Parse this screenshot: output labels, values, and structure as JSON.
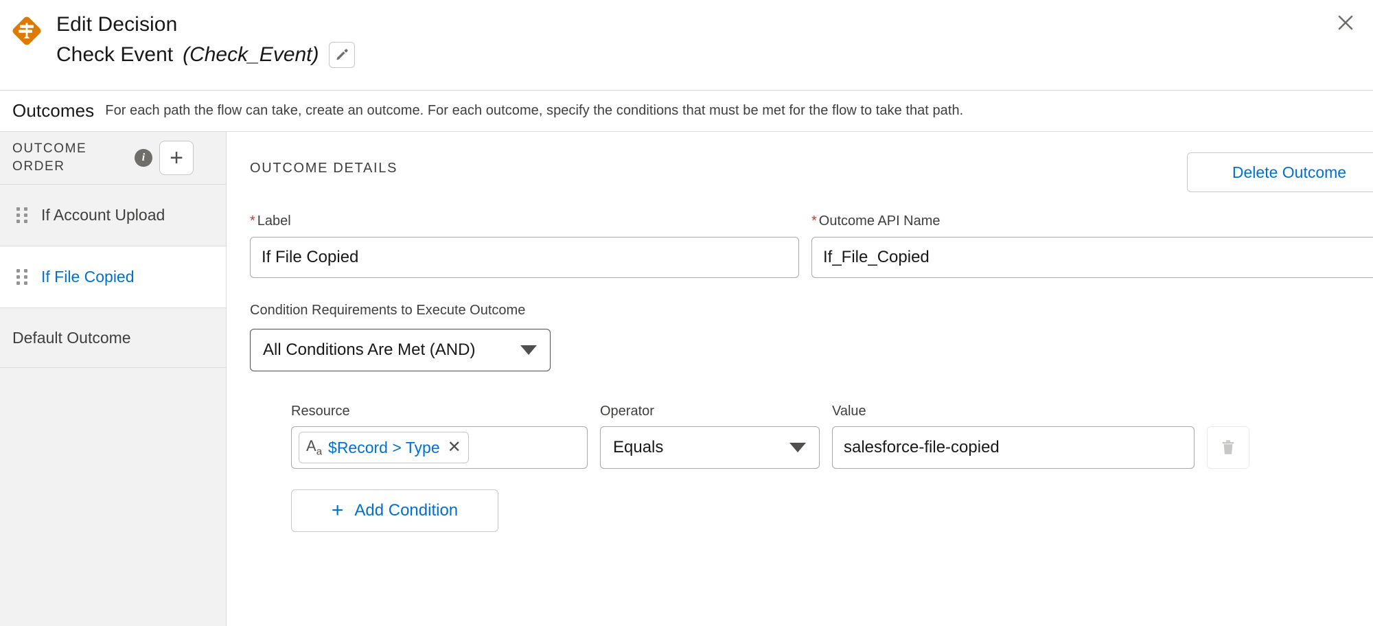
{
  "header": {
    "icon_name": "decision-diamond-icon",
    "title": "Edit Decision",
    "node_label": "Check Event",
    "node_api_name": "(Check_Event)",
    "edit_icon": "pencil-icon",
    "close_icon": "close-icon"
  },
  "outcomes_bar": {
    "title": "Outcomes",
    "description": "For each path the flow can take, create an outcome. For each outcome, specify the conditions that must be met for the flow to take that path."
  },
  "sidebar": {
    "heading": "OUTCOME ORDER",
    "info_icon": "info-icon",
    "info_glyph": "i",
    "add_button_icon": "plus-icon",
    "add_button_glyph": "+",
    "items": [
      {
        "label": "If Account Upload",
        "selected": false
      },
      {
        "label": "If File Copied",
        "selected": true
      }
    ],
    "default_outcome": "Default Outcome"
  },
  "details": {
    "section_title": "OUTCOME DETAILS",
    "delete_outcome_label": "Delete Outcome",
    "label_field": {
      "label": "Label",
      "required_marker": "*",
      "value": "If File Copied"
    },
    "api_name_field": {
      "label": "Outcome API Name",
      "required_marker": "*",
      "value": "If_File_Copied"
    },
    "condition_requirements": {
      "label": "Condition Requirements to Execute Outcome",
      "selected": "All Conditions Are Met (AND)",
      "caret_icon": "chevron-down-icon"
    },
    "condition_headers": {
      "resource": "Resource",
      "operator": "Operator",
      "value": "Value"
    },
    "condition": {
      "resource_pill_icon": "text-type-icon",
      "resource_pill_icon_main": "A",
      "resource_pill_icon_sub": "a",
      "resource_value": "$Record > Type",
      "resource_remove_icon": "close-icon",
      "resource_remove_glyph": "✕",
      "operator_value": "Equals",
      "operator_caret_icon": "chevron-down-icon",
      "value_value": "salesforce-file-copied",
      "delete_icon": "trash-icon"
    },
    "add_condition": {
      "icon": "plus-icon",
      "glyph": "+",
      "label": "Add Condition"
    }
  },
  "colors": {
    "accent_blue": "#0070d2",
    "decision_orange": "#dd7a01",
    "required_red": "#c23934",
    "sidebar_bg": "#f3f2f2",
    "border": "#dddbda"
  }
}
